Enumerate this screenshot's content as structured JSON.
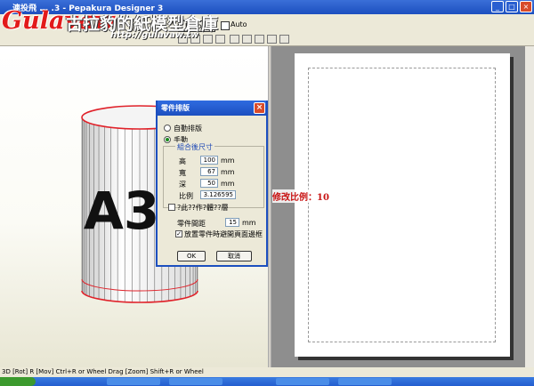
{
  "window": {
    "title": "連投飛 ... .3 - Pepakura Designer 3",
    "controls": [
      "_",
      "□",
      "×"
    ]
  },
  "logo": {
    "brand": "Gulavaw",
    "chinese": "古拉豹的紙模型倉庫",
    "url": "http://gulavaw.tw"
  },
  "toolbar": {
    "unfold_label": "Unfold",
    "auto_label": "Auto"
  },
  "model": {
    "text": "A3投環"
  },
  "dialog": {
    "title": "零件排版",
    "close": "×",
    "radio_auto": "自動排版",
    "radio_manual": "手動",
    "group_title": "組合後尺寸",
    "height_label": "高",
    "height_value": "100",
    "width_label": "寬",
    "width_value": "67",
    "depth_label": "深",
    "depth_value": "50",
    "unit": "mm",
    "scale_label": "比例",
    "scale_value": "3.126595",
    "keep_ratio_label": "?此??作?體??層",
    "spacing_label": "零件間距",
    "spacing_value": "15",
    "spacing_unit": "mm",
    "avoid_label": "放置零件時避開頁面邊框",
    "avoid_checked": true,
    "ok_label": "OK",
    "cancel_label": "取消"
  },
  "annotation": "修改比例：10",
  "status_text": "3D [Rot] R [Mov] Ctrl+R or Wheel Drag [Zoom] Shift+R or Wheel",
  "colors": {
    "titlebar": "#1c4fbf",
    "seam_red": "#e0222a",
    "annotation": "#c81414"
  }
}
